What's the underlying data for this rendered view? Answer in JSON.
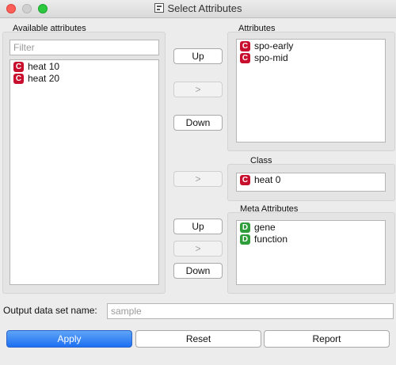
{
  "window": {
    "title": "Select Attributes"
  },
  "available": {
    "label": "Available attributes",
    "filter_placeholder": "Filter",
    "items": [
      {
        "type": "C",
        "name": "heat 10"
      },
      {
        "type": "C",
        "name": "heat 20"
      }
    ]
  },
  "attributes": {
    "label": "Attributes",
    "items": [
      {
        "type": "C",
        "name": "spo-early"
      },
      {
        "type": "C",
        "name": "spo-mid"
      }
    ]
  },
  "class": {
    "label": "Class",
    "items": [
      {
        "type": "C",
        "name": "heat 0"
      }
    ]
  },
  "meta": {
    "label": "Meta Attributes",
    "items": [
      {
        "type": "D",
        "name": "gene"
      },
      {
        "type": "D",
        "name": "function"
      }
    ]
  },
  "buttons": {
    "up": "Up",
    "move": ">",
    "down": "Down",
    "class_move": ">",
    "meta_up": "Up",
    "meta_move": ">",
    "meta_down": "Down"
  },
  "output": {
    "label": "Output data set name:",
    "placeholder": "sample",
    "value": ""
  },
  "footer": {
    "apply": "Apply",
    "reset": "Reset",
    "report": "Report"
  },
  "colors": {
    "continuous_badge": "#c8102e",
    "discrete_badge": "#2f9e3a",
    "primary_button": "#1d6ff2"
  }
}
